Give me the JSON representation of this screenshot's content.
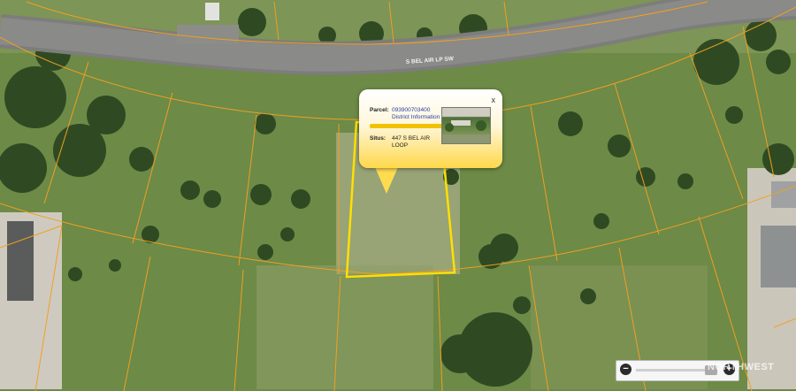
{
  "map": {
    "road_label": "S BEL AIR LP SW",
    "colors": {
      "parcel_line": "#f0a020",
      "selected_parcel": "#ffe000",
      "road": "#7d7d7b"
    }
  },
  "popup": {
    "close_label": "x",
    "parcel_label": "Parcel:",
    "parcel_value": "093900703400",
    "district_link": "District Information",
    "situs_label": "Situs:",
    "situs_value": "447 S BEL AIR LOOP"
  },
  "zoom_control": {
    "minus_label": "−",
    "plus_label": "+",
    "level": 0.92
  },
  "watermark": "NORTHWEST"
}
